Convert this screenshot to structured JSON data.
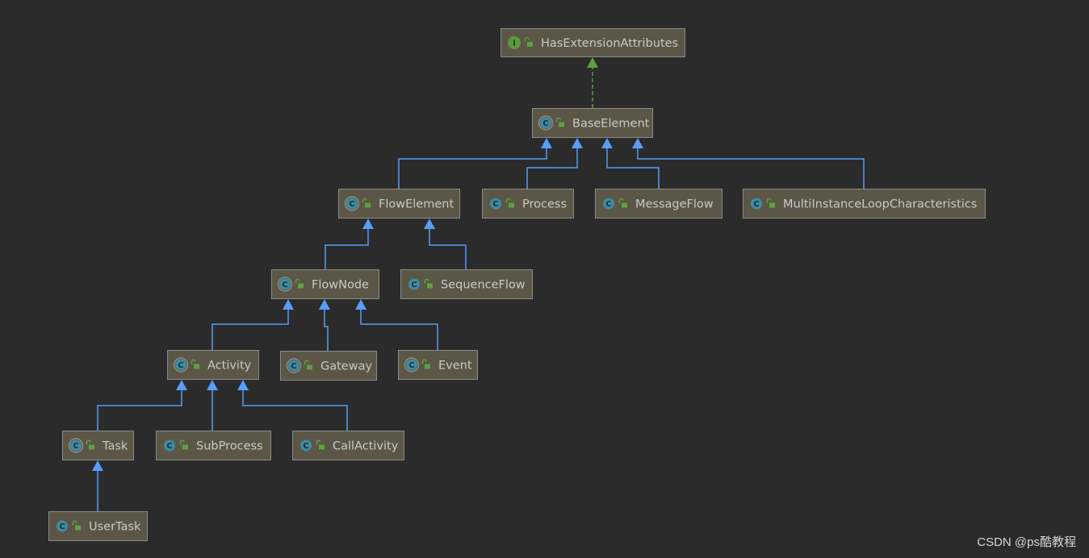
{
  "colors": {
    "background": "#2b2b2b",
    "node_fill": "#5b5646",
    "node_border": "#8b8b8b",
    "text": "#c9c9c9",
    "extends_line": "#589df6",
    "implements_line": "#5f9d3e",
    "class_icon": "#3e8ba0",
    "interface_icon": "#5a9a3c",
    "lock_icon": "#5fa040"
  },
  "nodes": [
    {
      "id": "HasExtensionAttributes",
      "label": "HasExtensionAttributes",
      "kind": "interface",
      "icon": "interface-icon"
    },
    {
      "id": "BaseElement",
      "label": "BaseElement",
      "kind": "abstract-class",
      "icon": "abstract-class-icon"
    },
    {
      "id": "FlowElement",
      "label": "FlowElement",
      "kind": "abstract-class",
      "icon": "abstract-class-icon"
    },
    {
      "id": "Process",
      "label": "Process",
      "kind": "class",
      "icon": "class-icon"
    },
    {
      "id": "MessageFlow",
      "label": "MessageFlow",
      "kind": "class",
      "icon": "class-icon"
    },
    {
      "id": "MultiInstanceLoopCharacteristics",
      "label": "MultiInstanceLoopCharacteristics",
      "kind": "class",
      "icon": "class-icon"
    },
    {
      "id": "FlowNode",
      "label": "FlowNode",
      "kind": "abstract-class",
      "icon": "abstract-class-icon"
    },
    {
      "id": "SequenceFlow",
      "label": "SequenceFlow",
      "kind": "class",
      "icon": "class-icon"
    },
    {
      "id": "Activity",
      "label": "Activity",
      "kind": "abstract-class",
      "icon": "abstract-class-icon"
    },
    {
      "id": "Gateway",
      "label": "Gateway",
      "kind": "abstract-class",
      "icon": "abstract-class-icon"
    },
    {
      "id": "Event",
      "label": "Event",
      "kind": "abstract-class",
      "icon": "abstract-class-icon"
    },
    {
      "id": "Task",
      "label": "Task",
      "kind": "abstract-class",
      "icon": "abstract-class-icon"
    },
    {
      "id": "SubProcess",
      "label": "SubProcess",
      "kind": "class",
      "icon": "class-icon"
    },
    {
      "id": "CallActivity",
      "label": "CallActivity",
      "kind": "class",
      "icon": "class-icon"
    },
    {
      "id": "UserTask",
      "label": "UserTask",
      "kind": "class",
      "icon": "class-icon"
    }
  ],
  "edges": [
    {
      "from": "BaseElement",
      "to": "HasExtensionAttributes",
      "type": "implements"
    },
    {
      "from": "FlowElement",
      "to": "BaseElement",
      "type": "extends"
    },
    {
      "from": "Process",
      "to": "BaseElement",
      "type": "extends"
    },
    {
      "from": "MessageFlow",
      "to": "BaseElement",
      "type": "extends"
    },
    {
      "from": "MultiInstanceLoopCharacteristics",
      "to": "BaseElement",
      "type": "extends"
    },
    {
      "from": "FlowNode",
      "to": "FlowElement",
      "type": "extends"
    },
    {
      "from": "SequenceFlow",
      "to": "FlowElement",
      "type": "extends"
    },
    {
      "from": "Activity",
      "to": "FlowNode",
      "type": "extends"
    },
    {
      "from": "Gateway",
      "to": "FlowNode",
      "type": "extends"
    },
    {
      "from": "Event",
      "to": "FlowNode",
      "type": "extends"
    },
    {
      "from": "Task",
      "to": "Activity",
      "type": "extends"
    },
    {
      "from": "SubProcess",
      "to": "Activity",
      "type": "extends"
    },
    {
      "from": "CallActivity",
      "to": "Activity",
      "type": "extends"
    },
    {
      "from": "UserTask",
      "to": "Task",
      "type": "extends"
    }
  ],
  "icon_letters": {
    "interface": "I",
    "class": "C"
  },
  "watermark": "CSDN @ps酷教程"
}
